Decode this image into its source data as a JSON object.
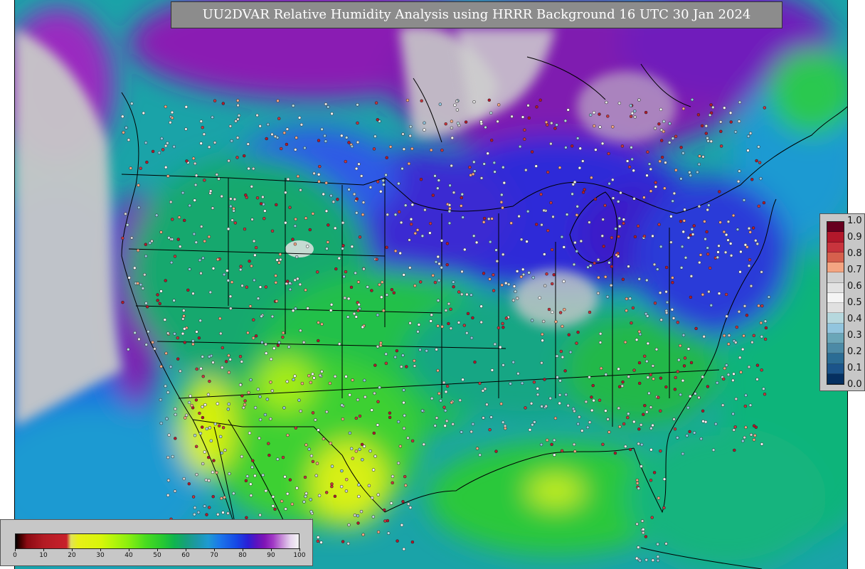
{
  "title": "UU2DVAR Relative Humidity Analysis using HRRR Background 16 UTC 30 Jan 2024",
  "station_legend": {
    "ticks": [
      "1.0",
      "0.9",
      "0.8",
      "0.7",
      "0.6",
      "0.5",
      "0.4",
      "0.3",
      "0.2",
      "0.1",
      "0.0"
    ],
    "colors": [
      "#67001f",
      "#b2182b",
      "#c8343d",
      "#d6604d",
      "#f4a582",
      "#d1d1d1",
      "#e2e2e2",
      "#f4f4f4",
      "#e0e0e0",
      "#b6d8de",
      "#92c5de",
      "#6aa6b8",
      "#4c8aa6",
      "#2b6c94",
      "#1b548a",
      "#053061"
    ]
  },
  "colorbar": {
    "ticks": [
      "0",
      "10",
      "20",
      "30",
      "40",
      "50",
      "60",
      "70",
      "80",
      "90",
      "100"
    ]
  },
  "colors": {
    "land_mask": "#c8c8c8",
    "ocean_teal": "#1aa3a8",
    "ocean_blue": "#1e7ad8",
    "humid_purple": "#8a1fb3",
    "dry_yellow": "#e6f01a",
    "moist_green": "#27c23a"
  }
}
